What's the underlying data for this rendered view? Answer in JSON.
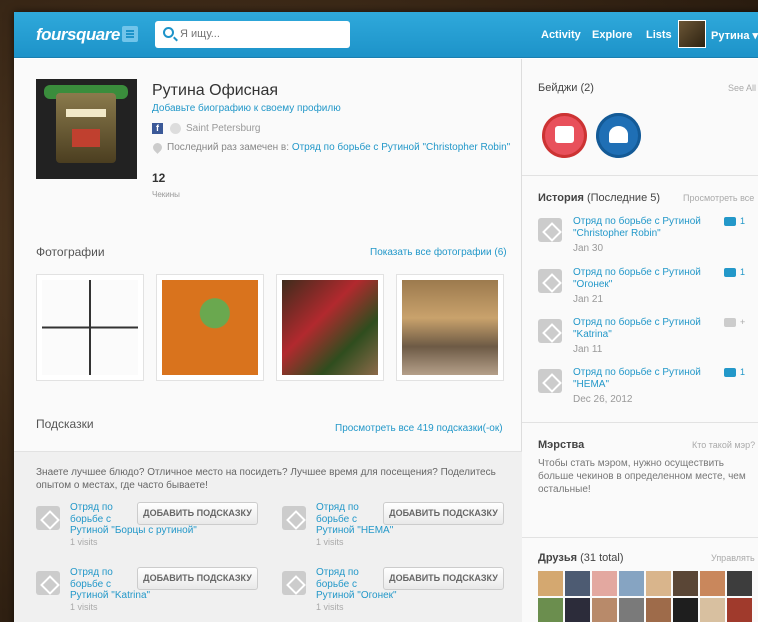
{
  "header": {
    "logo": "foursquare",
    "search_placeholder": "Я ищу...",
    "nav": [
      "Activity",
      "Explore",
      "Lists"
    ],
    "username": "Рутина ▾"
  },
  "profile": {
    "name": "Рутина Офисная",
    "bio_link": "Добавьте биографию к своему профилю",
    "city": "Saint Petersburg",
    "last_seen_prefix": "Последний раз замечен в:",
    "last_seen_venue": "Отряд по борьбе с Рутиной \"Christopher Robin\"",
    "checkins_count": "12",
    "checkins_label": "Чекины"
  },
  "photos": {
    "title": "Фотографии",
    "link": "Показать все фотографии (6)"
  },
  "tips": {
    "title": "Подсказки",
    "link": "Просмотреть все 419 подсказки(-ок)",
    "intro": "Знаете лучшее блюдо? Отличное место на посидеть? Лучшее время для посещения? Поделитесь опытом о местах, где часто бываете!",
    "button_label": "ДОБАВИТЬ ПОДСКАЗКУ",
    "venues": [
      {
        "line1": "Отряд по",
        "line2": "борьбе с",
        "line3": "Рутиной \"Борцы с рутиной\"",
        "visits": "1 visits"
      },
      {
        "line1": "Отряд по",
        "line2": "борьбе с",
        "line3": "Рутиной \"НЕМА\"",
        "visits": "1 visits"
      },
      {
        "line1": "Отряд по",
        "line2": "борьбе с",
        "line3": "Рутиной \"Katrina\"",
        "visits": "1 visits"
      },
      {
        "line1": "Отряд по",
        "line2": "борьбе с",
        "line3": "Рутиной \"Огонек\"",
        "visits": "1 visits"
      }
    ]
  },
  "badges": {
    "title": "Бейджи (2)",
    "link": "See All",
    "colors": [
      "#e8505b",
      "#1f6fb5"
    ]
  },
  "history": {
    "title": "История",
    "subtitle": "(Последние 5)",
    "link": "Просмотреть все",
    "items": [
      {
        "name": "Отряд по борьбе с Рутиной \"Christopher Robin\"",
        "date": "Jan 30",
        "icon": "camera-icon",
        "count": "1"
      },
      {
        "name": "Отряд по борьбе с Рутиной \"Огонек\"",
        "date": "Jan 21",
        "icon": "camera-icon",
        "count": "1"
      },
      {
        "name": "Отряд по борьбе с Рутиной \"Katrina\"",
        "date": "Jan 11",
        "icon": "comment-icon",
        "count": "+"
      },
      {
        "name": "Отряд по борьбе с Рутиной \"НЕМА\"",
        "date": "Dec 26, 2012",
        "icon": "camera-icon",
        "count": "1"
      }
    ]
  },
  "mayor": {
    "title": "Мэрства",
    "link": "Кто такой мэр?",
    "text": "Чтобы стать мэром, нужно осуществить больше чекинов в определенном месте, чем остальные!"
  },
  "friends": {
    "title": "Друзья",
    "count": "(31 total)",
    "link": "Управлять"
  },
  "colors": {
    "accent": "#2398c9",
    "header": "#1d93c9"
  }
}
